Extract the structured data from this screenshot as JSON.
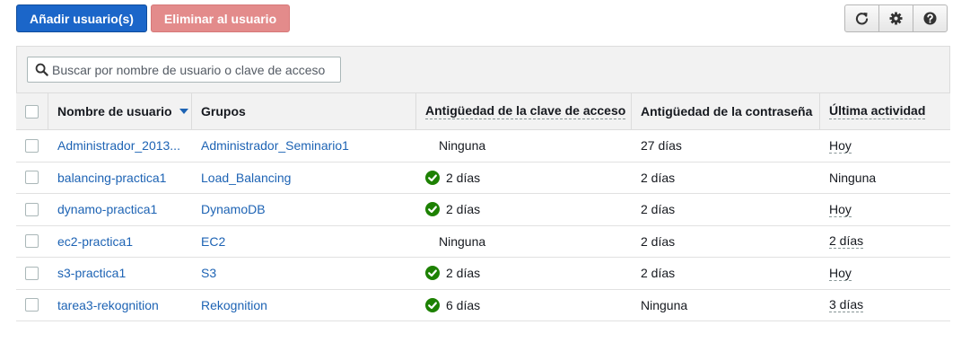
{
  "toolbar": {
    "add_users_label": "Añadir usuario(s)",
    "delete_user_label": "Eliminar al usuario",
    "icons": [
      "refresh-icon",
      "gear-icon",
      "help-icon"
    ]
  },
  "search": {
    "placeholder": "Buscar por nombre de usuario o clave de acceso",
    "value": ""
  },
  "table": {
    "columns": [
      "Nombre de usuario",
      "Grupos",
      "Antigüedad de la clave de acceso",
      "Antigüedad de la contraseña",
      "Última actividad"
    ],
    "sorted_column": "Nombre de usuario",
    "sort_direction": "descending",
    "rows": [
      {
        "user": "Administrador_2013...",
        "group": "Administrador_Seminario1",
        "key_age": "Ninguna",
        "key_ok": false,
        "password_age": "27 días",
        "last_activity": "Hoy",
        "activity_dashed": true
      },
      {
        "user": "balancing-practica1",
        "group": "Load_Balancing",
        "key_age": "2 días",
        "key_ok": true,
        "password_age": "2 días",
        "last_activity": "Ninguna",
        "activity_dashed": false
      },
      {
        "user": "dynamo-practica1",
        "group": "DynamoDB",
        "key_age": "2 días",
        "key_ok": true,
        "password_age": "2 días",
        "last_activity": "Hoy",
        "activity_dashed": true
      },
      {
        "user": "ec2-practica1",
        "group": "EC2",
        "key_age": "Ninguna",
        "key_ok": false,
        "password_age": "2 días",
        "last_activity": "2 días",
        "activity_dashed": true
      },
      {
        "user": "s3-practica1",
        "group": "S3",
        "key_age": "2 días",
        "key_ok": true,
        "password_age": "2 días",
        "last_activity": "Hoy",
        "activity_dashed": true
      },
      {
        "user": "tarea3-rekognition",
        "group": "Rekognition",
        "key_age": "6 días",
        "key_ok": true,
        "password_age": "Ninguna",
        "last_activity": "3 días",
        "activity_dashed": true
      }
    ]
  },
  "colors": {
    "primary": "#1b66c9",
    "danger": "#e38b8b",
    "link": "#1d63b4",
    "success": "#1d8102"
  }
}
